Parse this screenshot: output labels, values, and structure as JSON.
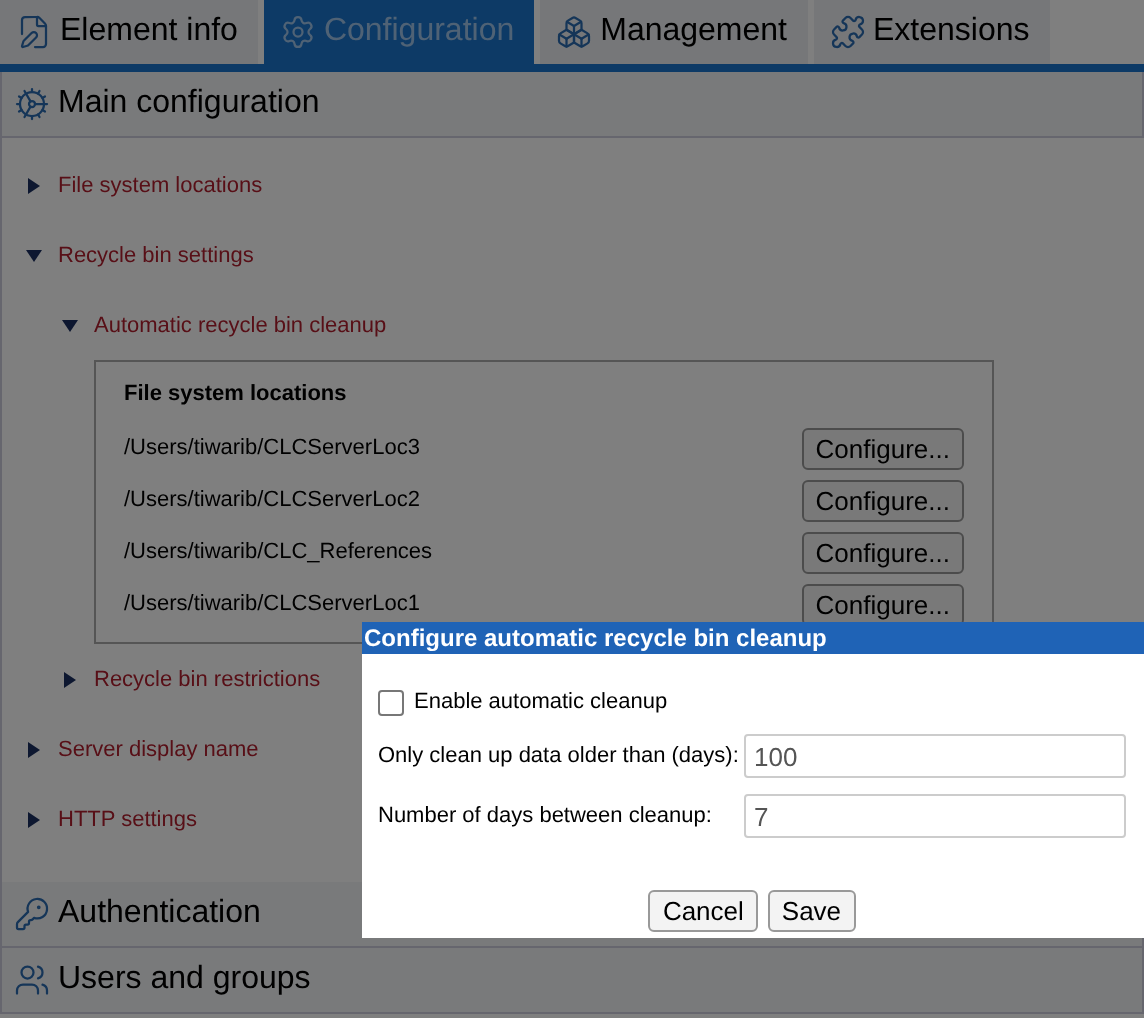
{
  "tabs": [
    {
      "label": "Element info",
      "selected": false
    },
    {
      "label": "Configuration",
      "selected": true
    },
    {
      "label": "Management",
      "selected": false
    },
    {
      "label": "Extensions",
      "selected": false
    }
  ],
  "main_section": {
    "title": "Main configuration",
    "tree": [
      {
        "label": "File system locations",
        "expanded": false
      },
      {
        "label": "Recycle bin settings",
        "expanded": true,
        "children": [
          {
            "label": "Automatic recycle bin cleanup",
            "expanded": true,
            "panel": {
              "title": "File system locations",
              "rows": [
                {
                  "path": "/Users/tiwarib/CLCServerLoc3",
                  "button": "Configure..."
                },
                {
                  "path": "/Users/tiwarib/CLCServerLoc2",
                  "button": "Configure..."
                },
                {
                  "path": "/Users/tiwarib/CLC_References",
                  "button": "Configure..."
                },
                {
                  "path": "/Users/tiwarib/CLCServerLoc1",
                  "button": "Configure..."
                }
              ]
            }
          },
          {
            "label": "Recycle bin restrictions",
            "expanded": false
          }
        ]
      },
      {
        "label": "Server display name",
        "expanded": false
      },
      {
        "label": "HTTP settings",
        "expanded": false
      }
    ]
  },
  "sections": [
    {
      "title": "Authentication"
    },
    {
      "title": "Users and groups"
    }
  ],
  "dialog": {
    "title": "Configure automatic recycle bin cleanup",
    "checkbox": {
      "label": "Enable automatic cleanup",
      "checked": false
    },
    "fields": [
      {
        "label": "Only clean up data older than (days):",
        "value": "100"
      },
      {
        "label": "Number of days between cleanup:",
        "value": "7"
      }
    ],
    "buttons": [
      "Cancel",
      "Save"
    ]
  }
}
